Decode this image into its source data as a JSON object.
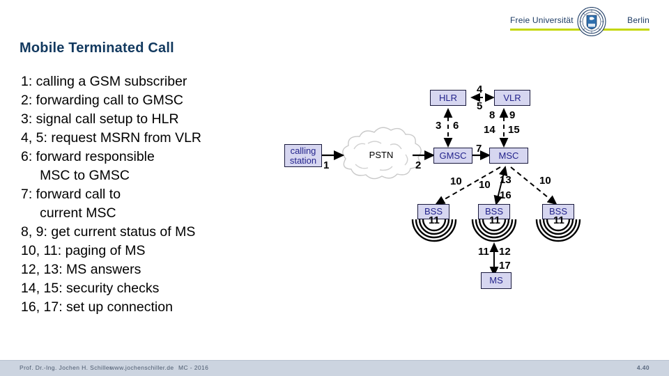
{
  "slide": {
    "title": "Mobile Terminated Call",
    "legend": [
      "1: calling a GSM subscriber",
      "2: forwarding call to GMSC",
      "3: signal call setup to HLR",
      "4, 5: request MSRN from VLR",
      "6: forward responsible",
      "     MSC to GMSC",
      "7: forward call to",
      "     current MSC",
      "8, 9: get current status of MS",
      "10, 11: paging of MS",
      "12, 13: MS answers",
      "14, 15: security checks",
      "16, 17: set up connection"
    ]
  },
  "logo": {
    "left_text": "Freie Universität",
    "right_text": "Berlin",
    "seal_name": "university-seal",
    "rule_color": "#c3d600",
    "text_color": "#1b3a63"
  },
  "diagram": {
    "nodes": {
      "calling_station_line1": "calling",
      "calling_station_line2": "station",
      "pstn": "PSTN",
      "gmsc": "GMSC",
      "msc": "MSC",
      "hlr": "HLR",
      "vlr": "VLR",
      "bss_left": "BSS",
      "bss_mid": "BSS",
      "bss_right": "BSS",
      "ms": "MS"
    },
    "edge_labels": {
      "station_to_pstn": "1",
      "pstn_to_gmsc": "2",
      "hlr_to_gmsc_down": "3",
      "hlr_to_gmsc_up": "6",
      "hlr_vlr_top": "4",
      "hlr_vlr_bottom": "5",
      "vlr_msc_8": "8",
      "vlr_msc_9": "9",
      "vlr_msc_14": "14",
      "vlr_msc_15": "15",
      "gmsc_to_msc": "7",
      "msc_to_bss_left": "10",
      "msc_to_bss_mid": "10",
      "msc_bss_mid_13": "13",
      "msc_bss_mid_16": "16",
      "msc_to_bss_right": "10",
      "bss_left_air": "11",
      "bss_mid_air": "11",
      "bss_right_air": "11",
      "ms_up": "11",
      "ms_down_12": "12",
      "ms_down_17": "17"
    },
    "colors": {
      "node_fill": "#d6d6f0",
      "node_border": "#18183c",
      "node_text": "#23238c",
      "cloud_stroke": "#c9c9c9"
    }
  },
  "footer": {
    "author": "Prof. Dr.-Ing. Jochen H. Schiller",
    "site": "www.jochenschiller.de",
    "course": "MC - 2016",
    "page": "4.40"
  }
}
